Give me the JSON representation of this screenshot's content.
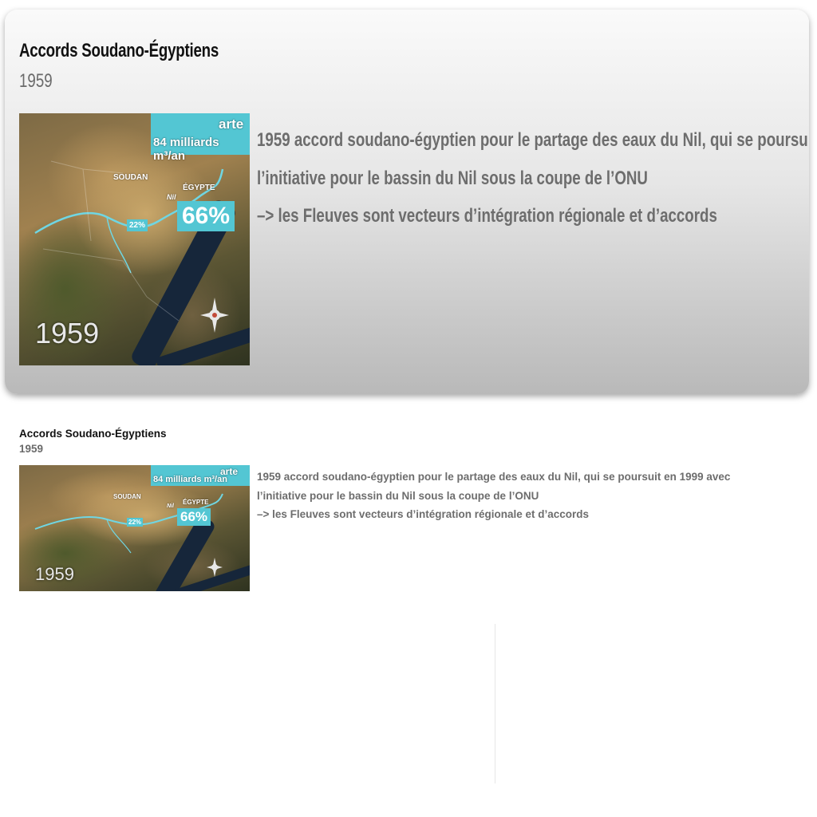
{
  "card": {
    "title": "Accords Soudano-Égyptiens",
    "year": "1959",
    "description": [
      "1959  accord soudano-égyptien pour le partage des eaux du Nil, qui se poursuit en 1999 avec",
      "l’initiative pour le bassin du Nil sous la coupe de l’ONU",
      " –> les Fleuves sont vecteurs d’intégration régionale et d’accords"
    ]
  },
  "thumbnail": {
    "brand": "arte",
    "flow_label": "84 milliards m³/an",
    "country_sudan": "SOUDAN",
    "country_egypt": "ÉGYPTE",
    "river": "Nil",
    "share_sudan": "22%",
    "share_egypt": "66%",
    "year": "1959"
  },
  "colors": {
    "tag": "#53c6d3",
    "river": "#6fd6e3",
    "sea": "#16263a"
  },
  "icons": {
    "compass": "compass-rose-icon"
  }
}
